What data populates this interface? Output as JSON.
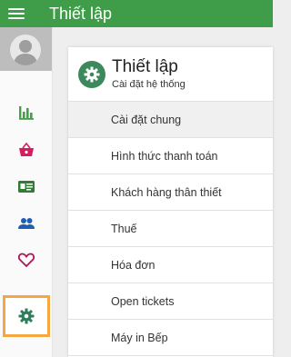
{
  "appbar": {
    "title": "Thiết lập"
  },
  "panel": {
    "title": "Thiết lập",
    "subtitle": "Cài đặt hệ thống"
  },
  "menu": [
    {
      "label": "Cài đặt chung"
    },
    {
      "label": "Hình thức thanh toán"
    },
    {
      "label": "Khách hàng thân thiết"
    },
    {
      "label": "Thuế"
    },
    {
      "label": "Hóa đơn"
    },
    {
      "label": "Open tickets"
    },
    {
      "label": "Máy in Bếp"
    }
  ],
  "sidebar": {
    "items": [
      {
        "icon": "bar-chart-icon",
        "color": "#43a047"
      },
      {
        "icon": "basket-icon",
        "color": "#d81b60"
      },
      {
        "icon": "id-card-icon",
        "color": "#2e7d32"
      },
      {
        "icon": "people-icon",
        "color": "#1e5fb4"
      },
      {
        "icon": "heart-icon",
        "color": "#ad1457"
      },
      {
        "icon": "gear-icon",
        "color": "#2e7d5b",
        "active": true
      }
    ]
  },
  "colors": {
    "appbar": "#3f9c48",
    "active_highlight": "#f5a742",
    "gear_badge": "#3c8a5c"
  }
}
